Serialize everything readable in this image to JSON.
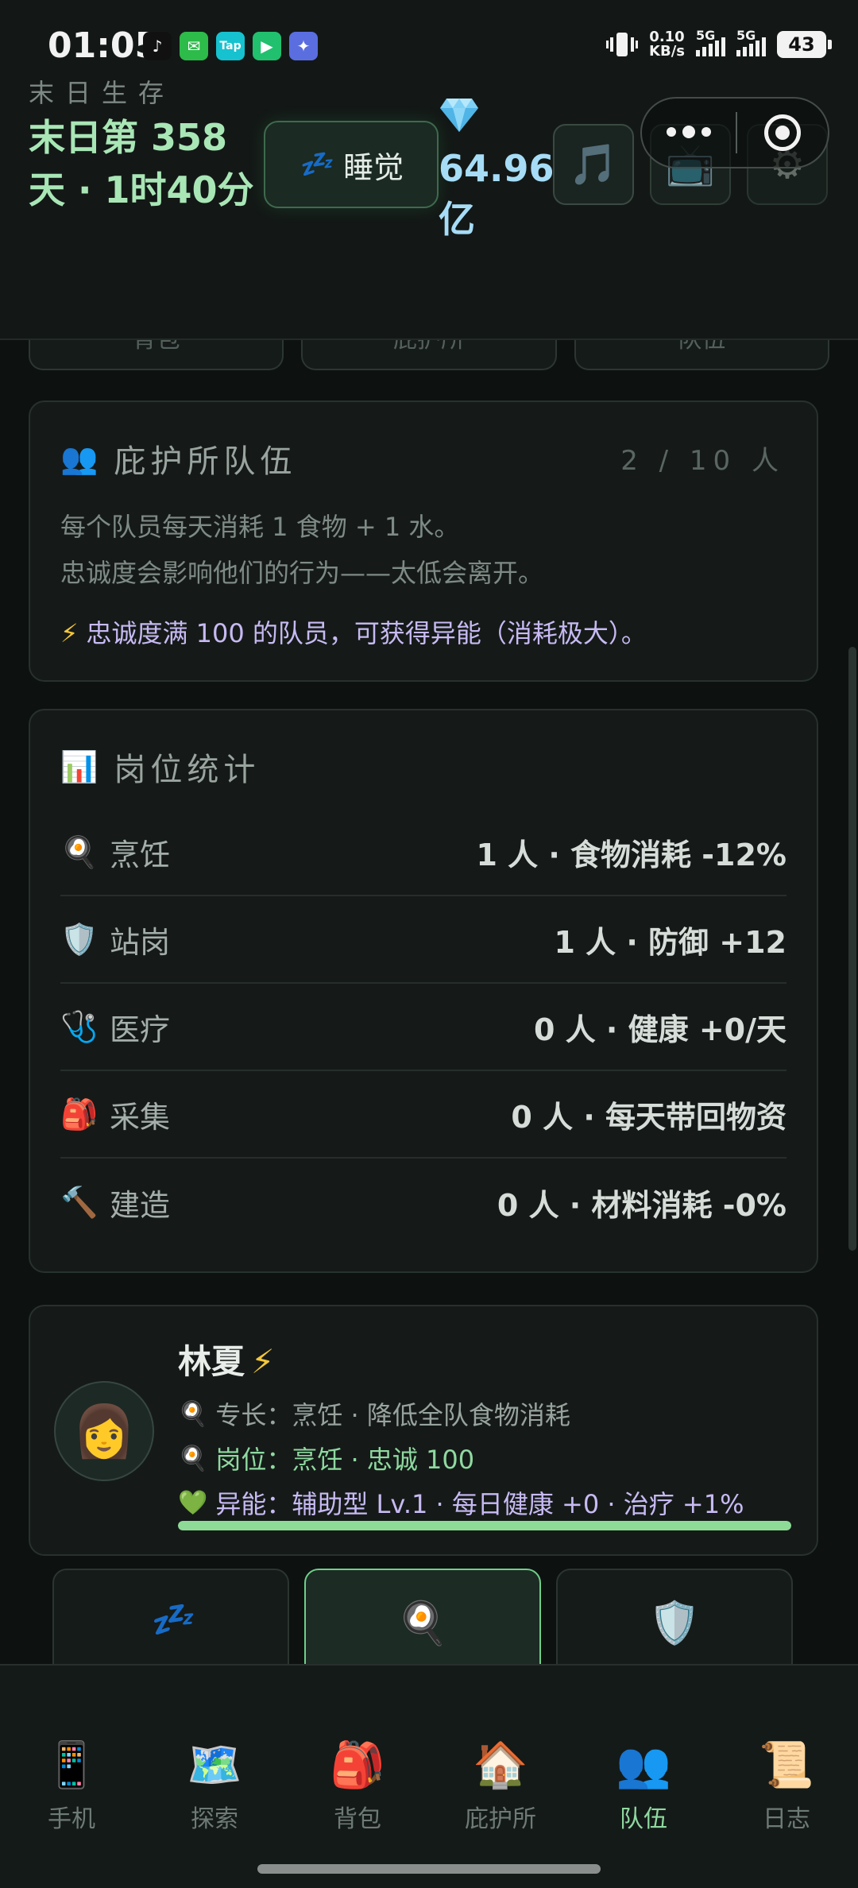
{
  "status_bar": {
    "time": "01:05",
    "apps": [
      {
        "name": "tiktok-icon",
        "glyph": "♪",
        "color": "#111111"
      },
      {
        "name": "wechat-icon",
        "glyph": "✉",
        "color": "#2dbb4a"
      },
      {
        "name": "taptap-icon",
        "glyph": "Tap",
        "color": "#16c2cf"
      },
      {
        "name": "video-app-icon",
        "glyph": "▶",
        "color": "#21c06e"
      },
      {
        "name": "game-app-icon",
        "glyph": "✦",
        "color": "#5a6ee0"
      }
    ],
    "speed_value": "0.10",
    "speed_unit": "KB/s",
    "signal1": "5G",
    "signal2": "5G",
    "battery": "43"
  },
  "header": {
    "app_title": "末日生存",
    "day_text": "末日第 358 天 · 1时40分",
    "sleep_icon": "💤",
    "sleep_label": "睡觉",
    "gem_value": "64.96亿",
    "music_icon": "🎵",
    "tv_icon": "📺",
    "gear_icon": "⚙"
  },
  "tabs_peek": [
    "背包",
    "庇护所",
    "队伍"
  ],
  "team_card": {
    "icon": "👥",
    "title": "庇护所队伍",
    "count": "2 / 10 人",
    "desc_line1": "每个队员每天消耗 1 食物 + 1 水。",
    "desc_line2": "忠诚度会影响他们的行为——太低会离开。",
    "tip_icon": "⚡",
    "tip": "忠诚度满 100 的队员，可获得异能（消耗极大）。"
  },
  "stats_card": {
    "icon": "📊",
    "title": "岗位统计",
    "rows": [
      {
        "icon": "🍳",
        "label": "烹饪",
        "value": "1 人 · 食物消耗 -12%"
      },
      {
        "icon": "🛡️",
        "label": "站岗",
        "value": "1 人 · 防御 +12"
      },
      {
        "icon": "🩺",
        "label": "医疗",
        "value": "0 人 · 健康 +0/天"
      },
      {
        "icon": "🎒",
        "label": "采集",
        "value": "0 人 · 每天带回物资"
      },
      {
        "icon": "🔨",
        "label": "建造",
        "value": "0 人 · 材料消耗 -0%"
      }
    ]
  },
  "member": {
    "avatar": "👩",
    "name": "林夏",
    "name_icon": "⚡",
    "specialty_icon": "🍳",
    "specialty": "专长：烹饪 · 降低全队食物消耗",
    "position_icon": "🍳",
    "position": "岗位：烹饪 · 忠诚 100",
    "ability_icon": "💚",
    "ability": "异能：辅助型 Lv.1 · 每日健康 +0 · 治疗 +1%",
    "loyalty_fraction": 1.0
  },
  "position_options": [
    {
      "icon": "💤",
      "active": false
    },
    {
      "icon": "🍳",
      "active": true
    },
    {
      "icon": "🛡️",
      "active": false
    }
  ],
  "bottom_nav": [
    {
      "icon": "📱",
      "label": "手机"
    },
    {
      "icon": "🗺️",
      "label": "探索"
    },
    {
      "icon": "🎒",
      "label": "背包"
    },
    {
      "icon": "🏠",
      "label": "庇护所"
    },
    {
      "icon": "👥",
      "label": "队伍",
      "active": true
    },
    {
      "icon": "📜",
      "label": "日志"
    }
  ],
  "colors": {
    "accent_green": "#8fd9a0",
    "gem_blue": "#a6dcf6",
    "tip_purple": "#c7baf3",
    "specialty_text": "#98a39e",
    "position_text": "#8fd9a0",
    "ability_text": "#c7baf3"
  }
}
